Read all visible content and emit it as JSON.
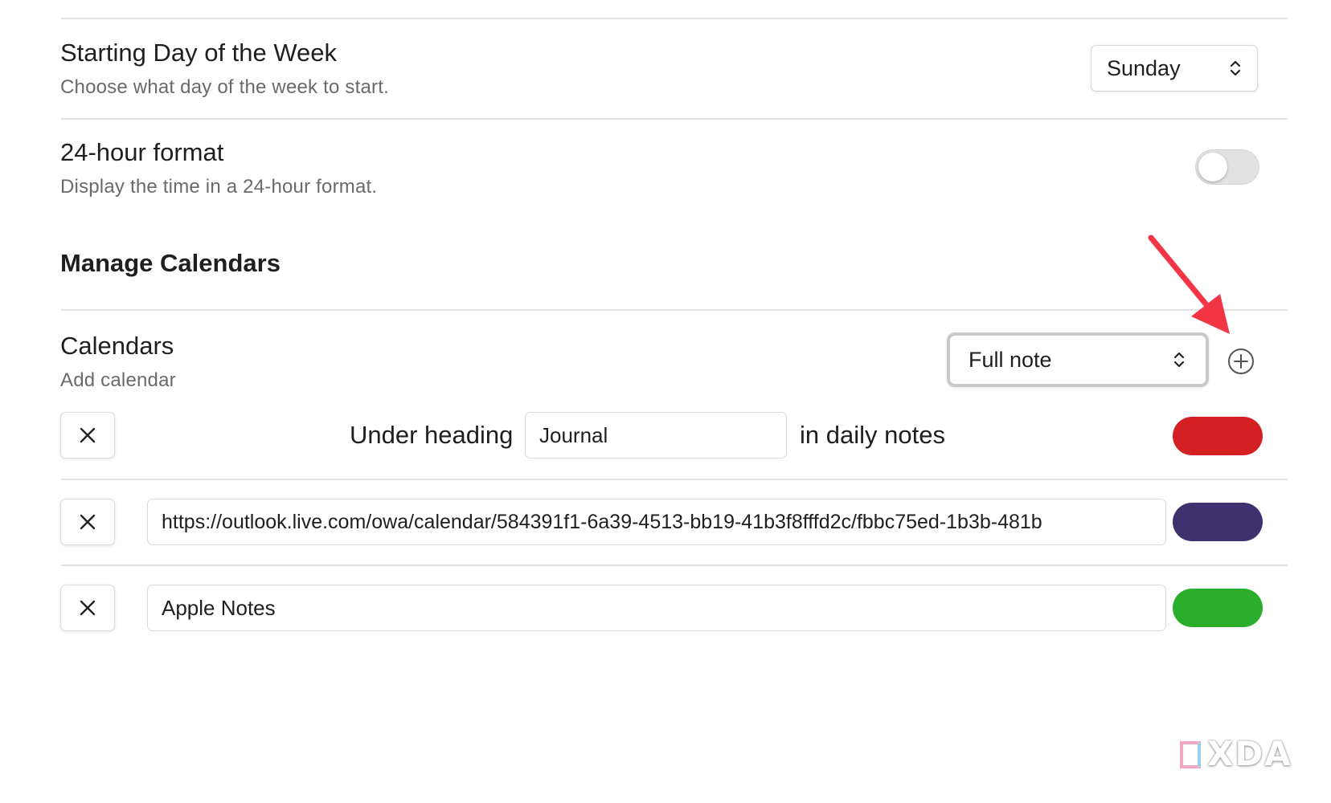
{
  "settings": {
    "starting_day": {
      "title": "Starting Day of the Week",
      "description": "Choose what day of the week to start.",
      "selected": "Sunday"
    },
    "hour_format": {
      "title": "24-hour format",
      "description": "Display the time in a 24-hour format.",
      "enabled": false
    }
  },
  "manage_calendars": {
    "heading": "Manage Calendars",
    "calendars_title": "Calendars",
    "calendars_description": "Add calendar",
    "note_mode_selected": "Full note",
    "add_icon": "plus-circle-icon"
  },
  "calendar_rows": [
    {
      "remove_icon": "close-icon",
      "prefix": "Under heading",
      "heading_value": "Journal",
      "suffix": "in daily notes",
      "color": "#d42022"
    },
    {
      "remove_icon": "close-icon",
      "url_value": "https://outlook.live.com/owa/calendar/584391f1-6a39-4513-bb19-41b3f8fffd2c/fbbc75ed-1b3b-481b",
      "color": "#3f3170"
    },
    {
      "remove_icon": "close-icon",
      "name_value": "Apple Notes",
      "color": "#2aad2a"
    }
  ],
  "colors": {
    "annotation_arrow": "#f23645"
  },
  "brand": {
    "text": "XDA"
  }
}
